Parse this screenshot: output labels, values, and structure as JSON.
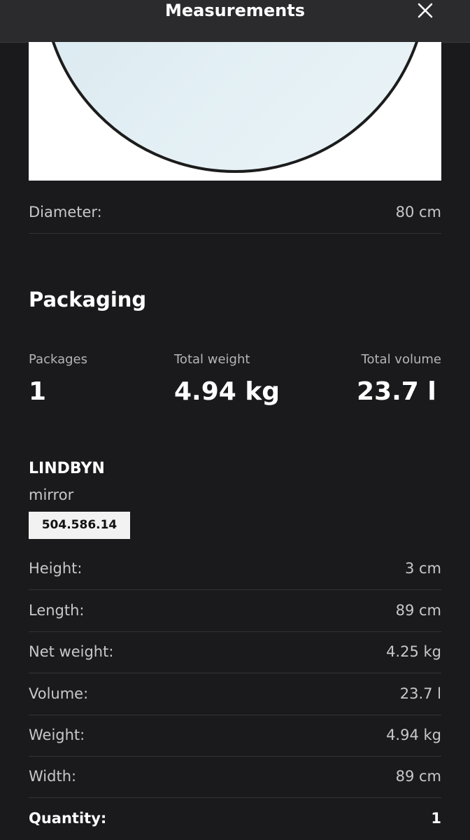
{
  "header": {
    "title": "Measurements"
  },
  "product_dimensions": [
    {
      "label": "Diameter:",
      "value": "80 cm"
    }
  ],
  "packaging": {
    "title": "Packaging",
    "stats": [
      {
        "label": "Packages",
        "value": "1"
      },
      {
        "label": "Total weight",
        "value": "4.94 kg"
      },
      {
        "label": "Total volume",
        "value": "23.7 l"
      }
    ],
    "product": {
      "name": "LINDBYN",
      "type": "mirror",
      "article_number": "504.586.14"
    },
    "rows": [
      {
        "label": "Height:",
        "value": "3 cm"
      },
      {
        "label": "Length:",
        "value": "89 cm"
      },
      {
        "label": "Net weight:",
        "value": "4.25 kg"
      },
      {
        "label": "Volume:",
        "value": "23.7 l"
      },
      {
        "label": "Weight:",
        "value": "4.94 kg"
      },
      {
        "label": "Width:",
        "value": "89 cm"
      },
      {
        "label": "Quantity:",
        "value": "1"
      }
    ]
  }
}
